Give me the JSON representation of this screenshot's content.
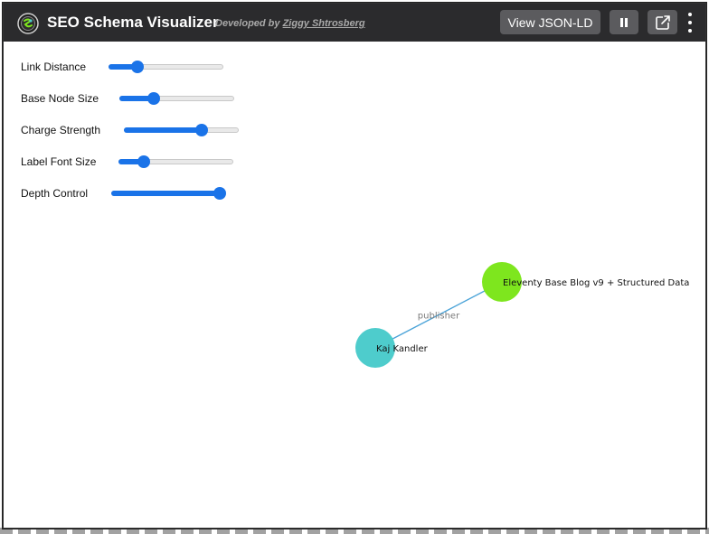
{
  "header": {
    "title": "SEO Schema Visualizer",
    "credit_prefix": "Developed by ",
    "credit_author": "Ziggy Shtrosberg",
    "view_button_label": "View JSON-LD"
  },
  "controls": [
    {
      "label": "Link Distance",
      "value": 0.25
    },
    {
      "label": "Base Node Size",
      "value": 0.3
    },
    {
      "label": "Charge Strength",
      "value": 0.68
    },
    {
      "label": "Label Font Size",
      "value": 0.22
    },
    {
      "label": "Depth Control",
      "value": 1.0
    }
  ],
  "graph": {
    "nodes": [
      {
        "id": "blog",
        "label": "Eleventy Base Blog v9 + Structured Data",
        "color": "#7ee61e"
      },
      {
        "id": "person",
        "label": "Kaj Kandler",
        "color": "#4ecccc"
      }
    ],
    "links": [
      {
        "source": "blog",
        "target": "person",
        "label": "publisher",
        "color": "#4aa3d8"
      }
    ]
  },
  "colors": {
    "header_bg": "#2b2b2d",
    "button_bg": "#5b5b5e",
    "slider_accent": "#1a73e8"
  }
}
